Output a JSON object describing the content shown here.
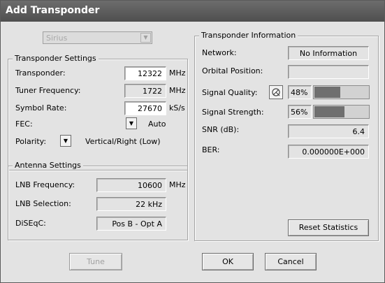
{
  "window": {
    "title": "Add Transponder"
  },
  "satellite": {
    "value": "Sirius"
  },
  "transponder_settings": {
    "group_label": "Transponder Settings",
    "transponder": {
      "label": "Transponder:",
      "value": "12322",
      "unit": "MHz"
    },
    "tuner_frequency": {
      "label": "Tuner Frequency:",
      "value": "1722",
      "unit": "MHz"
    },
    "symbol_rate": {
      "label": "Symbol Rate:",
      "value": "27670",
      "unit": "kS/s"
    },
    "fec": {
      "label": "FEC:",
      "value": "Auto"
    },
    "polarity": {
      "label": "Polarity:",
      "value": "Vertical/Right (Low)"
    }
  },
  "antenna_settings": {
    "group_label": "Antenna Settings",
    "lnb_frequency": {
      "label": "LNB Frequency:",
      "value": "10600",
      "unit": "MHz"
    },
    "lnb_selection": {
      "label": "LNB Selection:",
      "value": "22 kHz"
    },
    "diseqc": {
      "label": "DiSEqC:",
      "value": "Pos B - Opt A"
    }
  },
  "transponder_info": {
    "group_label": "Transponder Information",
    "network": {
      "label": "Network:",
      "value": "No Information"
    },
    "orbital_position": {
      "label": "Orbital Position:",
      "value": ""
    },
    "signal_quality": {
      "label": "Signal Quality:",
      "value": "48%",
      "level": 0.48
    },
    "signal_strength": {
      "label": "Signal Strength:",
      "value": "56%",
      "level": 0.56
    },
    "snr": {
      "label": "SNR (dB):",
      "value": "6.4"
    },
    "ber": {
      "label": "BER:",
      "value": "0.000000E+000"
    },
    "reset_label": "Reset Statistics"
  },
  "buttons": {
    "tune": "Tune",
    "ok": "OK",
    "cancel": "Cancel"
  },
  "icons": {
    "combo_arrow": "chevron-down-icon",
    "signal_tool": "satellite-dish-icon"
  }
}
